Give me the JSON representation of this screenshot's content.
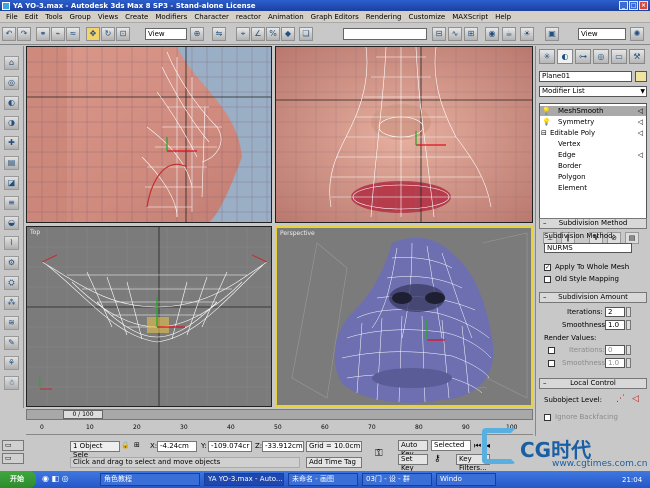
{
  "window": {
    "title": "YA YO-3.max - Autodesk 3ds Max 8 SP3  - Stand-alone License"
  },
  "menu": [
    "File",
    "Edit",
    "Tools",
    "Group",
    "Views",
    "Create",
    "Modifiers",
    "Character",
    "reactor",
    "Animation",
    "Graph Editors",
    "Rendering",
    "Customize",
    "MAXScript",
    "Help"
  ],
  "toolbar": {
    "view_select": "View",
    "view_select_right": "View"
  },
  "viewports": {
    "top_label": "Top",
    "persp_label": "Perspective"
  },
  "command_panel": {
    "object_name": "Plane01",
    "object_color": "#f0e4a0",
    "modifier_list": "Modifier List",
    "stack": [
      "MeshSmooth",
      "Symmetry",
      "Editable Poly",
      "Vertex",
      "Edge",
      "Border",
      "Polygon",
      "Element"
    ],
    "subdivision_method_title": "Subdivision Method",
    "subdivision_method_label": "Subdivision Method:",
    "subdivision_method_value": "NURMS",
    "apply_whole_mesh": "Apply To Whole Mesh",
    "old_style_mapping": "Old Style Mapping",
    "subdivision_amount_title": "Subdivision Amount",
    "iterations_label": "Iterations:",
    "iterations_value": "2",
    "smoothness_label": "Smoothness:",
    "smoothness_value": "1.0",
    "render_values_label": "Render Values:",
    "render_iterations_label": "Iterations:",
    "render_iterations_value": "0",
    "render_smoothness_label": "Smoothness:",
    "render_smoothness_value": "1.0",
    "local_control_title": "Local Control",
    "subobject_level_label": "Subobject Level:",
    "ignore_backfacing": "Ignore Backfacing"
  },
  "timeline": {
    "frame": "0 / 100",
    "ticks": [
      "0",
      "10",
      "20",
      "30",
      "40",
      "50",
      "60",
      "70",
      "80",
      "90",
      "100"
    ]
  },
  "status": {
    "selection": "1 Object Sele",
    "x_label": "X:",
    "x_value": "-4.24cm",
    "y_label": "Y:",
    "y_value": "-109.074cr",
    "z_label": "Z:",
    "z_value": "-33.912cm",
    "grid": "Grid = 10.0cm",
    "prompt": "Click and drag to select and move objects",
    "add_time_tag": "Add Time Tag",
    "auto_key": "Auto Key",
    "selected": "Selected",
    "set_key": "Set Key",
    "key_filters": "Key Filters..."
  },
  "watermark": {
    "brand": "CG时代",
    "url": "www.cgtimes.com.cn"
  },
  "taskbar": {
    "start": "开始",
    "tasks": [
      "角色教程",
      "YA YO-3.max - Auto...",
      "未命名 - 画图",
      "03门 - 设 - 群",
      "Windo"
    ],
    "clock": "21:04"
  }
}
